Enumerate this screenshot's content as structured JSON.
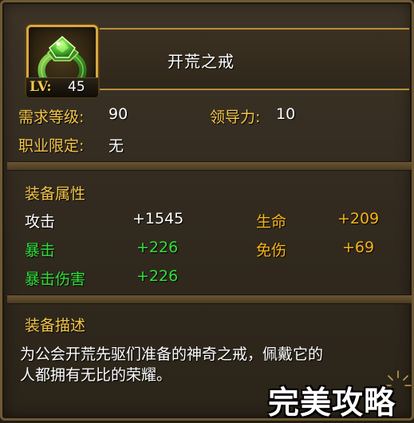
{
  "item": {
    "name": "开荒之戒",
    "level_label": "LV:",
    "level_value": "45",
    "icon": "green-gem-ring-icon"
  },
  "requirements": {
    "level_label": "需求等级:",
    "level_value": "90",
    "leadership_label": "领导力:",
    "leadership_value": "10",
    "class_label": "职业限定:",
    "class_value": "无"
  },
  "attributes": {
    "section_title": "装备属性",
    "attack_label": "攻击",
    "attack_value": "+1545",
    "hp_label": "生命",
    "hp_value": "+209",
    "crit_label": "暴击",
    "crit_value": "+226",
    "dmg_reduction_label": "免伤",
    "dmg_reduction_value": "+69",
    "crit_dmg_label": "暴击伤害",
    "crit_dmg_value": "+226"
  },
  "description": {
    "section_title": "装备描述",
    "line1": "为公会开荒先驱们准备的神奇之戒，佩戴它的",
    "line2": "人都拥有无比的荣耀。"
  },
  "watermark": {
    "text": "完美攻略"
  },
  "colors": {
    "gold_label": "#f3c54a",
    "green_stat": "#2fe03a",
    "orange_stat": "#f6b41a",
    "frame_gold": "#d7a742"
  }
}
